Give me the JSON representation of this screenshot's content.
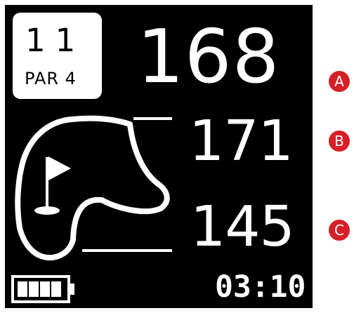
{
  "device": {
    "hole_number": "11",
    "par_label": "PAR 4",
    "distances": {
      "middle": "168",
      "back": "171",
      "front": "145"
    },
    "time": "03:10",
    "battery_level": 1.0
  },
  "annotations": {
    "a": "A",
    "b": "B",
    "c": "C",
    "marker_color": "#d61f26"
  },
  "colors": {
    "screen_background": "#000000",
    "screen_foreground": "#ffffff",
    "page_background": "#ffffff"
  }
}
